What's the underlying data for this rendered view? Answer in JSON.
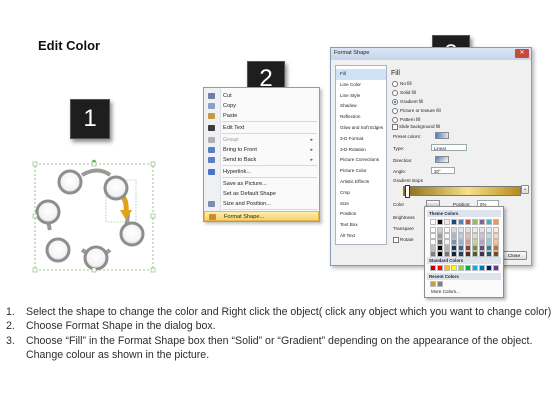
{
  "title": "Edit Color",
  "steps": [
    "1",
    "2",
    "3"
  ],
  "context_menu": {
    "items": [
      {
        "label": "Cut",
        "icon": "scissors-icon",
        "color": "#6d7fa8"
      },
      {
        "label": "Copy",
        "icon": "copy-icon",
        "color": "#8aa0c8"
      },
      {
        "label": "Paste",
        "icon": "paste-icon",
        "color": "#c49a45"
      },
      {
        "label": "Edit Text",
        "icon": "text-icon",
        "color": "#3a3a3a"
      },
      {
        "label": "Group",
        "icon": "group-icon",
        "color": "#b0b0b0",
        "arrow": "▸",
        "disabled": true
      },
      {
        "label": "Bring to Front",
        "icon": "bring-front-icon",
        "color": "#5a7fc0",
        "arrow": "▸"
      },
      {
        "label": "Send to Back",
        "icon": "send-back-icon",
        "color": "#5a7fc0",
        "arrow": "▸"
      },
      {
        "label": "Hyperlink...",
        "icon": "hyperlink-icon",
        "color": "#4a74c9"
      },
      {
        "label": "Save as Picture...",
        "icon": "",
        "color": ""
      },
      {
        "label": "Set as Default Shape",
        "icon": "",
        "color": ""
      },
      {
        "label": "Size and Position...",
        "icon": "size-icon",
        "color": "#7a8fb0"
      },
      {
        "label": "Format Shape...",
        "icon": "format-shape-icon",
        "color": "#d08a2a",
        "highlighted": true
      }
    ]
  },
  "dialog": {
    "title": "Format Shape",
    "close": "✕",
    "nav": [
      "Fill",
      "Line Color",
      "Line Style",
      "Shadow",
      "Reflection",
      "Glow and Soft Edges",
      "3-D Format",
      "3-D Rotation",
      "Picture Corrections",
      "Picture Color",
      "Artistic Effects",
      "Crop",
      "Size",
      "Position",
      "Text Box",
      "Alt Text"
    ],
    "section": "Fill",
    "fill_options": [
      "No fill",
      "Solid fill",
      "Gradient fill",
      "Picture or texture fill",
      "Pattern fill"
    ],
    "selected_fill": "Gradient fill",
    "slide_bg": "Slide background fill",
    "preset_colors": "Preset colors:",
    "type_label": "Type:",
    "type_value": "Linear",
    "direction_label": "Direction:",
    "angle_label": "Angle:",
    "angle_value": "30°",
    "gradient_stops": "Gradient stops",
    "color_label": "Color",
    "position_label": "Position:",
    "position_value": "0%",
    "brightness_label": "Brightness",
    "transparency_label": "Transpare",
    "rotate_label": "Rotate",
    "close_button": "Close"
  },
  "palette": {
    "theme_header": "Theme Colors",
    "standard_header": "Standard Colors",
    "recent_header": "Recent Colors",
    "more": "More Colors...",
    "theme_top": [
      "#ffffff",
      "#000000",
      "#eeece1",
      "#1f497d",
      "#4f81bd",
      "#c0504d",
      "#9bbb59",
      "#8064a2",
      "#4bacc6",
      "#f79646"
    ],
    "standard": [
      "#c00000",
      "#ff0000",
      "#ffc000",
      "#ffff00",
      "#92d050",
      "#00b050",
      "#00b0f0",
      "#0070c0",
      "#002060",
      "#7030a0"
    ],
    "recent": [
      "#c8a032",
      "#808080"
    ]
  },
  "instructions": [
    {
      "num": "1.",
      "text": "Select the shape to change the color and Right click the object( click any object which you want to change color)"
    },
    {
      "num": "2.",
      "text": "Choose Format Shape in the dialog box."
    },
    {
      "num": "3.",
      "text": "Choose “Fill” in the Format Shape box then “Solid” or “Gradient” depending on the appearance of the object. Change colour as shown in the picture."
    }
  ],
  "colors": {
    "accent_gold": "#e0a21a",
    "ring_gray": "#9a9a9a",
    "step_box": "#1e1e1e"
  }
}
